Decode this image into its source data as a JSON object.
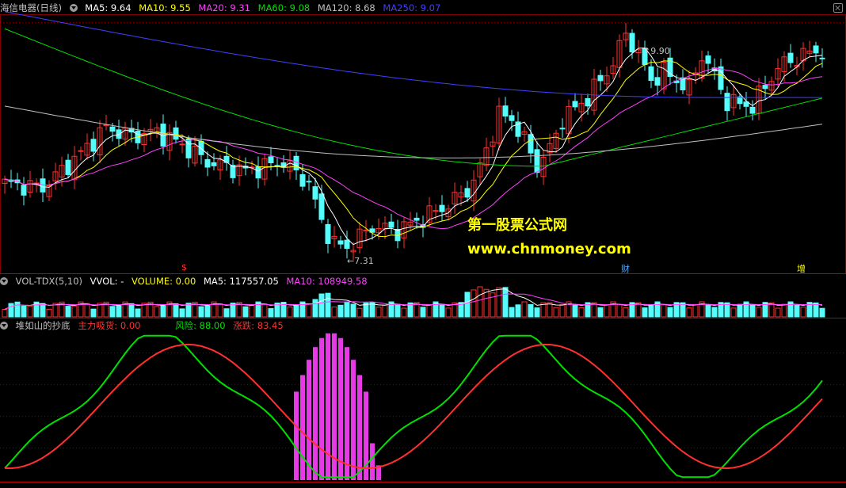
{
  "main_legend": {
    "title": "海信电器(日线)",
    "items": [
      {
        "label": "MA5: 9.64",
        "color": "#ffffff"
      },
      {
        "label": "MA10: 9.55",
        "color": "#ffff00"
      },
      {
        "label": "MA20: 9.31",
        "color": "#ff40ff"
      },
      {
        "label": "MA60: 9.08",
        "color": "#00e000"
      },
      {
        "label": "MA120: 8.68",
        "color": "#c0c0c0"
      },
      {
        "label": "MA250: 9.07",
        "color": "#4040ff"
      }
    ]
  },
  "vol_legend": {
    "items": [
      {
        "label": "VOL-TDX(5,10)",
        "color": "#c0c0c0"
      },
      {
        "label": "VVOL: -",
        "color": "#ffffff"
      },
      {
        "label": "VOLUME: 0.00",
        "color": "#ffff00"
      },
      {
        "label": "MA5: 117557.05",
        "color": "#ffffff"
      },
      {
        "label": "MA10: 108949.58",
        "color": "#ff40ff"
      }
    ]
  },
  "ind_legend": {
    "items": [
      {
        "label": "堆如山的抄底",
        "color": "#c0c0c0"
      },
      {
        "label": "主力吸货: 0.00",
        "color": "#ff3030"
      },
      {
        "label": "风险: 88.00",
        "color": "#00e000"
      },
      {
        "label": "涨跌: 83.45",
        "color": "#ff3030"
      }
    ]
  },
  "annotations": {
    "high": "9.90",
    "low": "7.31",
    "marker_s": "$",
    "marker_cai": "财",
    "marker_zeng": "增"
  },
  "watermark": {
    "line1": "第一股票公式网",
    "line2": "www.chnmoney.com"
  },
  "colors": {
    "up": "#ff3030",
    "down": "#54fcfc",
    "grid": "#800000",
    "ma5": "#ffffff",
    "ma10": "#ffff00",
    "ma20": "#ff40ff",
    "ma60": "#00e000",
    "ma120": "#c0c0c0",
    "ma250": "#4040ff",
    "risk": "#00e000",
    "change": "#ff3030",
    "accumulate": "#ff40ff"
  },
  "chart_data": [
    {
      "type": "candlestick",
      "price_range": [
        7.1,
        10.05
      ],
      "high_point": 9.9,
      "low_point": 7.31,
      "series": [
        {
          "name": "MA5",
          "last": 9.64
        },
        {
          "name": "MA10",
          "last": 9.55
        },
        {
          "name": "MA20",
          "last": 9.31
        },
        {
          "name": "MA60",
          "last": 9.08
        },
        {
          "name": "MA120",
          "last": 8.68
        },
        {
          "name": "MA250",
          "last": 9.07
        }
      ]
    },
    {
      "type": "bar",
      "series": [
        {
          "name": "MA5",
          "last": 117557.05
        },
        {
          "name": "MA10",
          "last": 108949.58
        }
      ]
    },
    {
      "type": "line",
      "ylim": [
        0,
        100
      ],
      "series": [
        {
          "name": "主力吸货",
          "last": 0.0
        },
        {
          "name": "风险",
          "last": 88.0
        },
        {
          "name": "涨跌",
          "last": 83.45
        }
      ]
    }
  ]
}
